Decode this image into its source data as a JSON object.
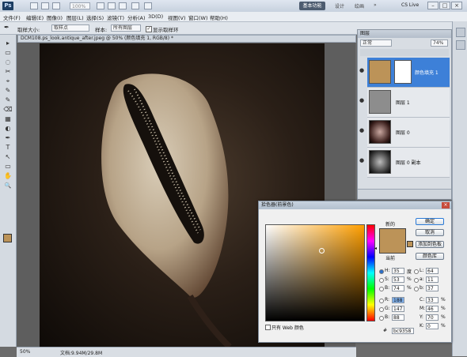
{
  "app": {
    "logo": "Ps"
  },
  "titlebar": {
    "zoom": "100%",
    "workspace": "基本功能",
    "workspace_links": [
      "设计",
      "绘画",
      "»"
    ],
    "cs_live": "CS Live",
    "controls": [
      "–",
      "□",
      "×"
    ]
  },
  "menu": [
    "文件(F)",
    "编辑(E)",
    "图像(I)",
    "图层(L)",
    "选择(S)",
    "滤镜(T)",
    "分析(A)",
    "3D(D)",
    "视图(V)",
    "窗口(W)",
    "帮助(H)"
  ],
  "options": {
    "sample_size_label": "取样大小:",
    "sample_size": "取样点",
    "sample_label": "样本:",
    "sample": "所有图层",
    "show_ring": "显示取样环"
  },
  "document": {
    "tab": "DCM108.ps_look.antique_after.jpeg @ 50% (颜色填充 1, RGB/8) *"
  },
  "status": {
    "zoom": "50%",
    "doc": "文档:9.94M/29.8M"
  },
  "layers": {
    "title": "图层",
    "mode": "正常",
    "opacity": "74%",
    "rows": [
      {
        "name": "颜色填充 1",
        "selected": true
      },
      {
        "name": "图层 1",
        "selected": false
      },
      {
        "name": "图层 0",
        "selected": false
      },
      {
        "name": "图层 0 副本",
        "selected": false
      }
    ]
  },
  "picker": {
    "title": "拾色器(前景色)",
    "new_label": "新的",
    "current_label": "当前",
    "buttons": {
      "ok": "确定",
      "cancel": "取消",
      "add_swatch": "添加到色板",
      "libraries": "颜色库"
    },
    "web_only": "只有 Web 颜色",
    "fields": {
      "H": "35",
      "H_unit": "度",
      "S": "53",
      "S_unit": "%",
      "B": "74",
      "B_unit": "%",
      "R": "188",
      "G": "147",
      "B2": "88",
      "L": "64",
      "a": "11",
      "b": "37",
      "C": "33",
      "M": "46",
      "Y": "70",
      "K": "0",
      "pct": "%",
      "hex_label": "#",
      "hex": "bc9358"
    },
    "new_color": "#bc9358",
    "current_color": "#bc9358"
  },
  "tools": [
    "▸",
    "▭",
    "◌",
    "✂",
    "⌖",
    "✎",
    "✎",
    "⌫",
    "▦",
    "◐",
    "✒",
    "T",
    "↖",
    "▭",
    "✋",
    "🔍"
  ]
}
